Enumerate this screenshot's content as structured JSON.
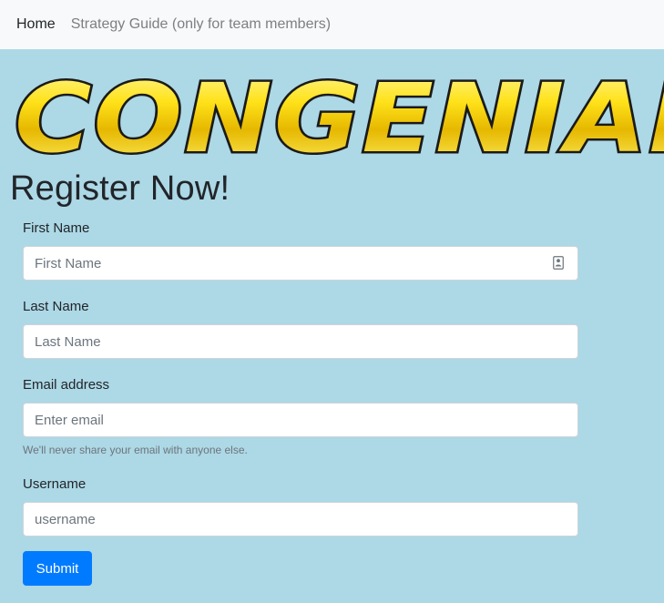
{
  "nav": {
    "home_label": "Home",
    "guide_label": "Strategy Guide (only for team members)"
  },
  "logo": {
    "text": "CONGENIAL"
  },
  "page": {
    "title": "Register Now!"
  },
  "form": {
    "first_name": {
      "label": "First Name",
      "placeholder": "First Name",
      "value": ""
    },
    "last_name": {
      "label": "Last Name",
      "placeholder": "Last Name",
      "value": ""
    },
    "email": {
      "label": "Email address",
      "placeholder": "Enter email",
      "value": "",
      "help": "We'll never share your email with anyone else."
    },
    "username": {
      "label": "Username",
      "placeholder": "username",
      "value": ""
    },
    "submit_label": "Submit"
  },
  "colors": {
    "background": "#add8e6",
    "navbar": "#f8f9fa",
    "primary": "#007bff",
    "logo_fill": "#ffd700"
  },
  "icons": {
    "autofill": "contact-card-icon"
  }
}
